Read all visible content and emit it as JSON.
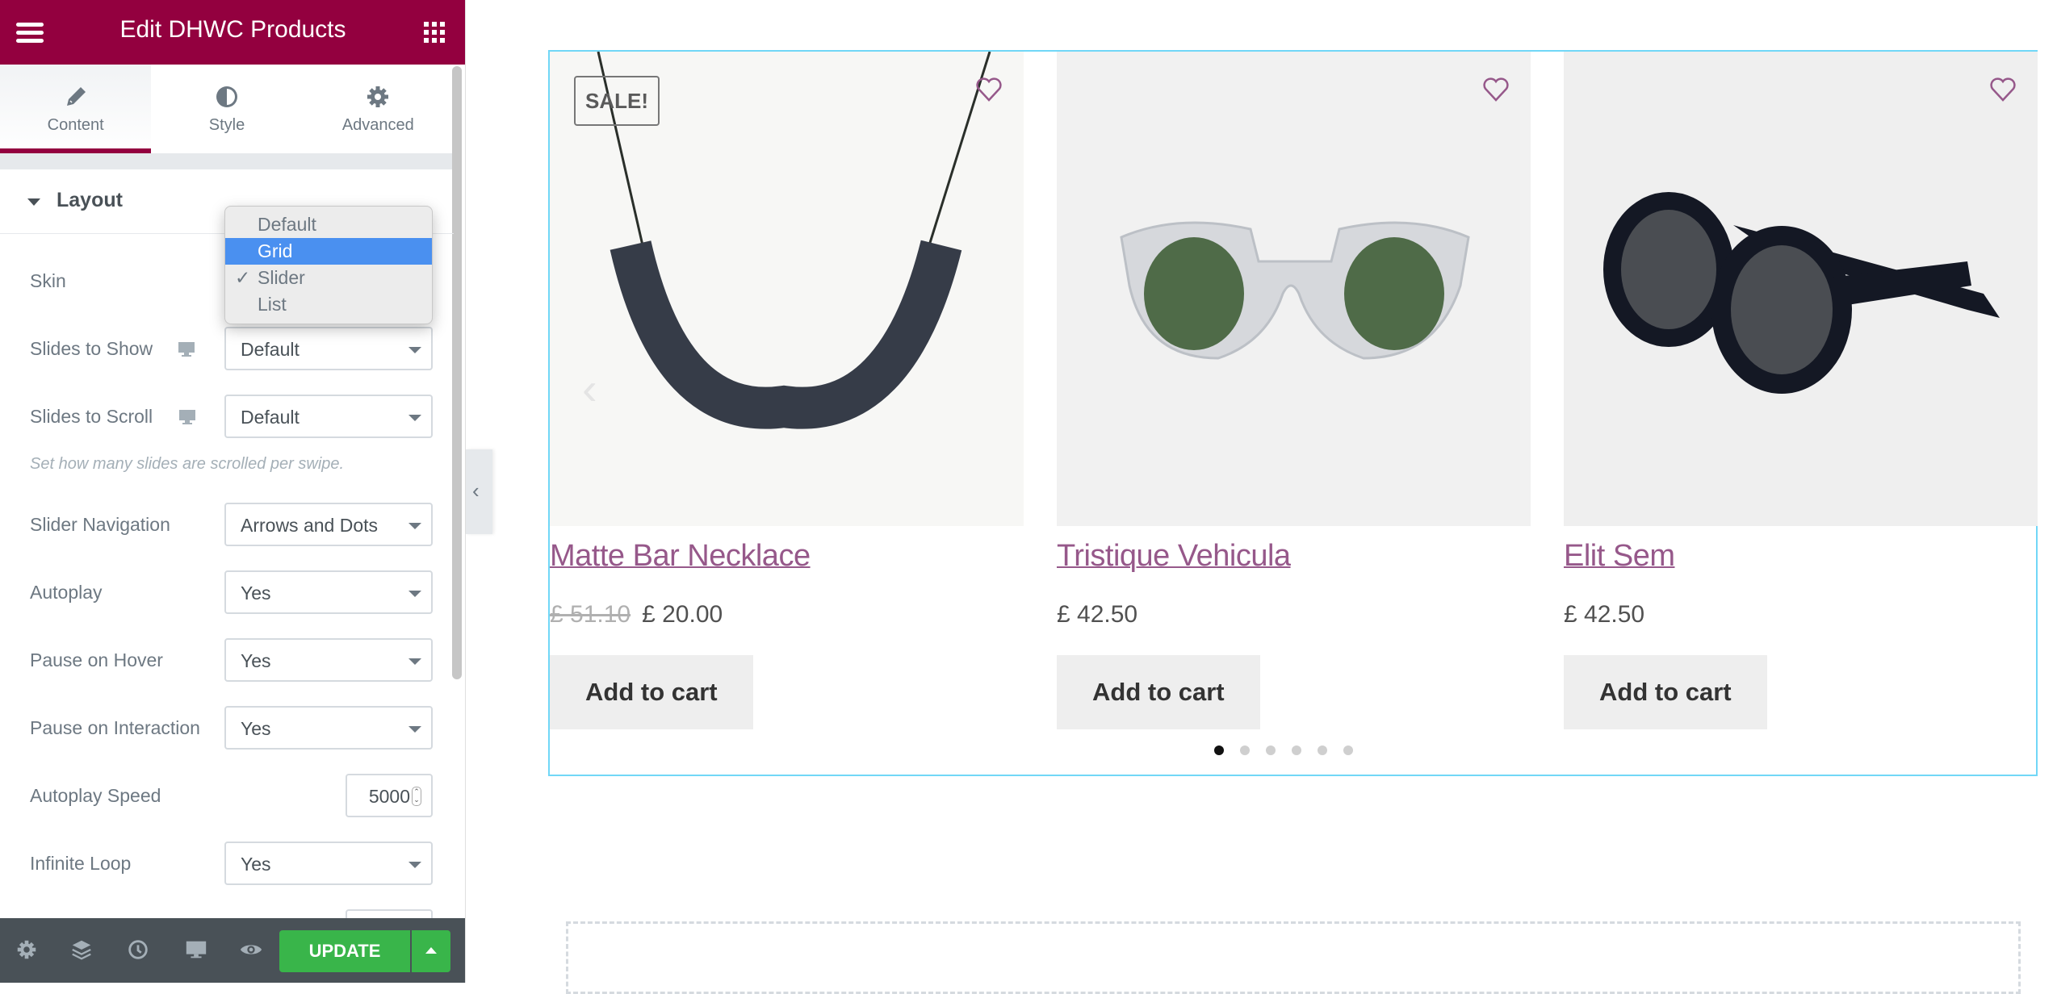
{
  "header": {
    "title": "Edit DHWC Products",
    "menu_icon": "hamburger-icon",
    "apps_icon": "grid-icon"
  },
  "tabs": [
    {
      "label": "Content",
      "icon": "pencil-icon",
      "active": true
    },
    {
      "label": "Style",
      "icon": "contrast-icon",
      "active": false
    },
    {
      "label": "Advanced",
      "icon": "gear-icon",
      "active": false
    }
  ],
  "section": {
    "title": "Layout"
  },
  "controls": {
    "skin": {
      "label": "Skin",
      "value": "Slider"
    },
    "slides_to_show": {
      "label": "Slides to Show",
      "value": "Default"
    },
    "slides_to_scroll": {
      "label": "Slides to Scroll",
      "value": "Default",
      "help": "Set how many slides are scrolled per swipe."
    },
    "slider_navigation": {
      "label": "Slider Navigation",
      "value": "Arrows and Dots"
    },
    "autoplay": {
      "label": "Autoplay",
      "value": "Yes"
    },
    "pause_on_hover": {
      "label": "Pause on Hover",
      "value": "Yes"
    },
    "pause_on_interaction": {
      "label": "Pause on Interaction",
      "value": "Yes"
    },
    "autoplay_speed": {
      "label": "Autoplay Speed",
      "value": "5000"
    },
    "infinite_loop": {
      "label": "Infinite Loop",
      "value": "Yes"
    }
  },
  "skin_dropdown": {
    "options": [
      "Default",
      "Grid",
      "Slider",
      "List"
    ],
    "highlighted": "Grid",
    "checked": "Slider",
    "check_mark": "✓"
  },
  "footer": {
    "icons": [
      "gear-icon",
      "layers-icon",
      "history-icon",
      "desktop-icon",
      "eye-icon"
    ],
    "update_label": "UPDATE"
  },
  "preview": {
    "products": [
      {
        "name": "Matte Bar Necklace",
        "old_price": "£ 51.10",
        "price": "£ 20.00",
        "sale_badge": "SALE!",
        "button": "Add to cart"
      },
      {
        "name": "Tristique Vehicula",
        "price": "£ 42.50",
        "button": "Add to cart"
      },
      {
        "name": "Elit Sem",
        "price": "£ 42.50",
        "button": "Add to cart"
      }
    ],
    "dots": {
      "count": 6,
      "active_index": 0
    },
    "colors": {
      "accent": "#96588a",
      "brand": "#93003f",
      "selection_border": "#71d7f7",
      "update_green": "#39b54a"
    }
  }
}
